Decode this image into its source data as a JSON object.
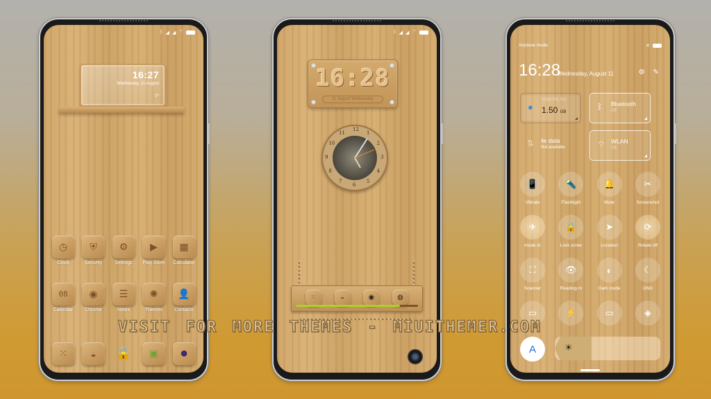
{
  "watermark": "VISIT FOR MORE THEMES - MIUITHEMER.COM",
  "home_screen": {
    "widget": {
      "time": "16:27",
      "date": "Wednesday, 11 August",
      "temperature": "0°"
    },
    "apps_row1": [
      {
        "label": "Clock",
        "icon": "clock-icon",
        "glyph": "◷"
      },
      {
        "label": "Security",
        "icon": "shield-icon",
        "glyph": "⛨"
      },
      {
        "label": "Settings",
        "icon": "gear-icon",
        "glyph": "⚙"
      },
      {
        "label": "Play Store",
        "icon": "play-icon",
        "glyph": "▶"
      },
      {
        "label": "Calculator",
        "icon": "calculator-icon",
        "glyph": "▦"
      }
    ],
    "apps_row2": [
      {
        "label": "Calendar",
        "icon": "calendar-icon",
        "glyph": "08"
      },
      {
        "label": "Chrome",
        "icon": "chrome-icon",
        "glyph": "◉"
      },
      {
        "label": "Notes",
        "icon": "notes-icon",
        "glyph": "☰"
      },
      {
        "label": "Themes",
        "icon": "themes-icon",
        "glyph": "✺"
      },
      {
        "label": "Contacts",
        "icon": "contacts-icon",
        "glyph": "👤"
      }
    ],
    "dock": [
      {
        "icon": "phone-dialer-icon",
        "glyph": "⁙"
      },
      {
        "icon": "messages-icon",
        "glyph": "◒"
      },
      {
        "icon": "lock-icon",
        "glyph": "🔒"
      },
      {
        "icon": "gallery-icon",
        "glyph": "▣"
      },
      {
        "icon": "camera-icon",
        "glyph": "●"
      }
    ]
  },
  "lock_screen": {
    "time": "16:28",
    "date": "11 August Wednesday",
    "clock_numbers": [
      "12",
      "1",
      "2",
      "3",
      "4",
      "5",
      "6",
      "7",
      "8",
      "9",
      "10",
      "11"
    ],
    "shortcuts": [
      {
        "icon": "dialer-icon",
        "glyph": "⁙"
      },
      {
        "icon": "messages-icon",
        "glyph": "◒"
      },
      {
        "icon": "music-icon",
        "glyph": "◉"
      },
      {
        "icon": "camera-icon",
        "glyph": "◍"
      }
    ],
    "progress_fraction": 0.85
  },
  "control_center": {
    "status_text": "Airplane mode",
    "time": "16:28",
    "date": "Wednesday, August 11",
    "data_tile": {
      "title": "Used this mo",
      "value": "1.50",
      "unit": "GB"
    },
    "mobile_data": {
      "title": "ile data",
      "sub": "Not available"
    },
    "bluetooth": {
      "title": "Bluetooth",
      "sub": "Off"
    },
    "wlan": {
      "title": "WLAN",
      "sub": "Off"
    },
    "toggles_row1": [
      {
        "label": "Vibrate",
        "glyph": "📳",
        "on": false
      },
      {
        "label": "Flashlight",
        "glyph": "🔦",
        "on": false
      },
      {
        "label": "Mute",
        "glyph": "🔔",
        "on": false
      },
      {
        "label": "Screenshot",
        "glyph": "✂",
        "on": false
      }
    ],
    "toggles_row2": [
      {
        "label": "mode   Ai",
        "glyph": "✈",
        "on": true
      },
      {
        "label": "Lock scree",
        "glyph": "🔒",
        "on": false
      },
      {
        "label": "Location",
        "glyph": "➤",
        "on": false
      },
      {
        "label": "Rotate off",
        "glyph": "⟳",
        "on": true
      }
    ],
    "toggles_row3": [
      {
        "label": "Scanner",
        "glyph": "⛶",
        "on": false
      },
      {
        "label": "Reading m",
        "glyph": "👁",
        "on": false
      },
      {
        "label": "Dark mode",
        "glyph": "◐",
        "on": false
      },
      {
        "label": "DND",
        "glyph": "☾",
        "on": false
      }
    ],
    "toggles_row4": [
      {
        "label": "",
        "glyph": "▭",
        "on": false
      },
      {
        "label": "",
        "glyph": "⚡",
        "on": false
      },
      {
        "label": "",
        "glyph": "▭",
        "on": false
      },
      {
        "label": "",
        "glyph": "◈",
        "on": false
      }
    ],
    "auto_brightness_label": "A",
    "brightness_fraction": 0.35
  }
}
